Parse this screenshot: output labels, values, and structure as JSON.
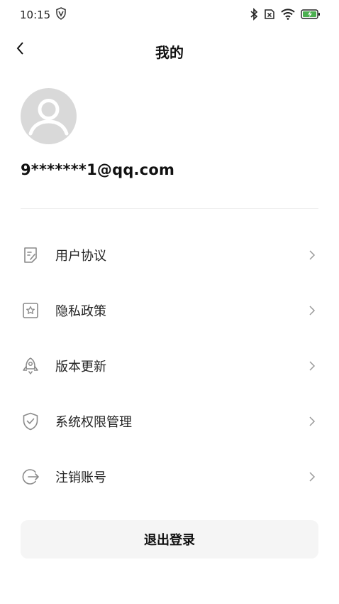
{
  "status_bar": {
    "time": "10:15",
    "icons": [
      "vpn-icon",
      "bluetooth-icon",
      "sim-disabled-icon",
      "wifi-icon",
      "battery-charging-icon"
    ],
    "battery_color": "#4caf50"
  },
  "header": {
    "title": "我的",
    "back_icon": "chevron-left-icon"
  },
  "profile": {
    "avatar_icon": "default-avatar-icon",
    "email": "9*******1@qq.com"
  },
  "menu": {
    "items": [
      {
        "label": "用户协议",
        "icon": "document-edit-icon"
      },
      {
        "label": "隐私政策",
        "icon": "star-square-icon"
      },
      {
        "label": "版本更新",
        "icon": "rocket-icon"
      },
      {
        "label": "系统权限管理",
        "icon": "shield-check-icon"
      },
      {
        "label": "注销账号",
        "icon": "logout-icon"
      }
    ],
    "chevron_icon": "chevron-right-icon"
  },
  "logout": {
    "label": "退出登录"
  },
  "colors": {
    "background": "#ffffff",
    "text": "#111111",
    "icon": "#8a8a8a",
    "button_bg": "#f5f5f5"
  }
}
